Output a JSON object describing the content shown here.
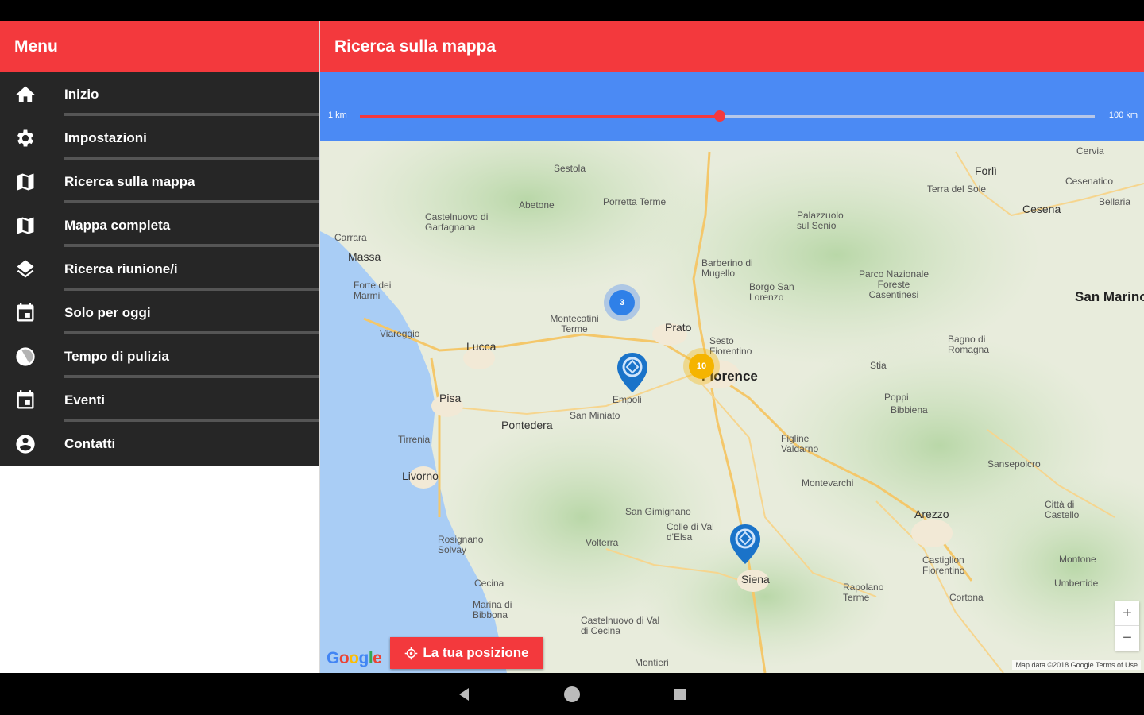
{
  "sidebar": {
    "title": "Menu",
    "items": [
      {
        "label": "Inizio",
        "icon": "home-icon"
      },
      {
        "label": "Impostazioni",
        "icon": "gear-icon"
      },
      {
        "label": "Ricerca sulla mappa",
        "icon": "map-icon"
      },
      {
        "label": "Mappa completa",
        "icon": "map-icon"
      },
      {
        "label": "Ricerca riunione/i",
        "icon": "layers-icon"
      },
      {
        "label": "Solo per oggi",
        "icon": "calendar-icon"
      },
      {
        "label": "Tempo di pulizia",
        "icon": "clock-icon"
      },
      {
        "label": "Eventi",
        "icon": "calendar-icon"
      },
      {
        "label": "Contatti",
        "icon": "account-icon"
      }
    ]
  },
  "main": {
    "title": "Ricerca sulla mappa",
    "range": {
      "min_label": "1 km",
      "max_label": "100 km",
      "value_fraction": 0.49
    }
  },
  "map": {
    "places": [
      "Sestola",
      "Abetone",
      "Porretta Terme",
      "Castelnuovo di Garfagnana",
      "Carrara",
      "Massa",
      "Forte dei Marmi",
      "Viareggio",
      "Lucca",
      "Pisa",
      "Pontedera",
      "Tirrenia",
      "Livorno",
      "Montecatini Terme",
      "Prato",
      "Barberino di Mugello",
      "Borgo San Lorenzo",
      "Sesto Fiorentino",
      "Florence",
      "Empoli",
      "San Miniato",
      "Figline Valdarno",
      "Montevarchi",
      "San Gimignano",
      "Colle di Val d'Elsa",
      "Volterra",
      "Siena",
      "Rosignano Solvay",
      "Cecina",
      "Marina di Bibbona",
      "Castelnuovo di Val di Cecina",
      "Arezzo",
      "Castiglion Fiorentino",
      "Cortona",
      "Rapolano Terme",
      "Città di Castello",
      "Sansepolcro",
      "Forlì",
      "Cesena",
      "Cesenatico",
      "Cervia",
      "Bellaria",
      "Terra del Sole",
      "Palazzuolo sul Senio",
      "Parco Nazionale Foreste Casentinesi",
      "Bagno di Romagna",
      "Stia",
      "Poppi",
      "Bibbiena",
      "San Marino",
      "Montone",
      "Umbertide",
      "Montieri"
    ],
    "cluster_blue_count": "3",
    "cluster_yellow_count": "10",
    "google": "Google",
    "attribution": "Map data ©2018 Google   Terms of Use",
    "zoom_in": "+",
    "zoom_out": "−",
    "locate_label": "La tua posizione",
    "colors": {
      "header": "#f3393d",
      "range_panel": "#4285f4",
      "pin": "#1a73c9",
      "cluster_yellow": "#f5b400"
    }
  },
  "navbar": {
    "back": "back-icon",
    "home": "home-circle-icon",
    "recents": "recents-icon"
  }
}
